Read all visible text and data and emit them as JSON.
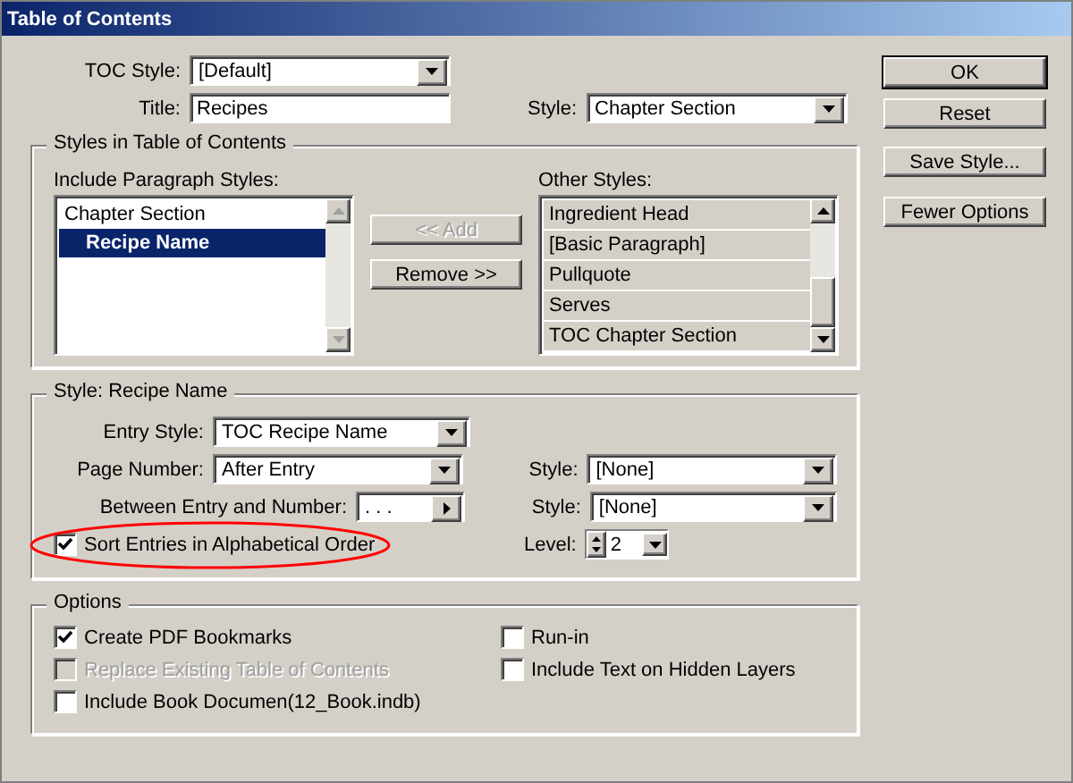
{
  "window": {
    "title": "Table of Contents"
  },
  "toc_style": {
    "label": "TOC Style:",
    "value": "[Default]"
  },
  "title": {
    "label": "Title:",
    "value": "Recipes"
  },
  "title_style": {
    "label": "Style:",
    "value": "Chapter Section"
  },
  "styles_group": {
    "heading": "Styles in Table of Contents",
    "include_label": "Include Paragraph Styles:",
    "include_items": [
      {
        "label": "Chapter Section",
        "selected": false,
        "children": [
          {
            "label": "Recipe Name",
            "selected": true
          }
        ]
      }
    ],
    "add_button": {
      "label": "<< Add",
      "disabled": true
    },
    "remove_button": {
      "label": "Remove >>",
      "disabled": false
    },
    "other_label": "Other Styles:",
    "other_items": [
      {
        "label": "Ingredient Head",
        "selected": false
      },
      {
        "label": "[Basic Paragraph]",
        "selected": false
      },
      {
        "label": "Pullquote",
        "selected": false
      },
      {
        "label": "Serves",
        "selected": false
      },
      {
        "label": "TOC Chapter Section",
        "selected": false
      }
    ]
  },
  "style_group": {
    "heading": "Style: Recipe Name",
    "entry_style": {
      "label": "Entry Style:",
      "value": "TOC Recipe Name"
    },
    "page_number": {
      "label": "Page Number:",
      "value": "After Entry"
    },
    "page_number_style": {
      "label": "Style:",
      "value": "[None]"
    },
    "between": {
      "label": "Between Entry and Number:",
      "value": ". . ."
    },
    "between_style": {
      "label": "Style:",
      "value": "[None]"
    },
    "sort": {
      "label": "Sort Entries in Alphabetical Order",
      "checked": true,
      "circled": true
    },
    "level": {
      "label": "Level:",
      "value": "2"
    }
  },
  "options": {
    "heading": "Options",
    "left": [
      {
        "label": "Create PDF Bookmarks",
        "checked": true,
        "disabled": false
      },
      {
        "label": "Replace Existing Table of Contents",
        "checked": false,
        "disabled": true
      },
      {
        "label": "Include Book Documen(12_Book.indb)",
        "checked": false,
        "disabled": false
      }
    ],
    "right": [
      {
        "label": "Run-in",
        "checked": false,
        "disabled": false
      },
      {
        "label": "Include Text on Hidden Layers",
        "checked": false,
        "disabled": false
      }
    ]
  },
  "buttons": [
    {
      "label": "OK",
      "default": true
    },
    {
      "label": "Reset",
      "default": false
    },
    {
      "label": "Save Style...",
      "default": false
    },
    {
      "label": "Fewer Options",
      "default": false
    }
  ]
}
